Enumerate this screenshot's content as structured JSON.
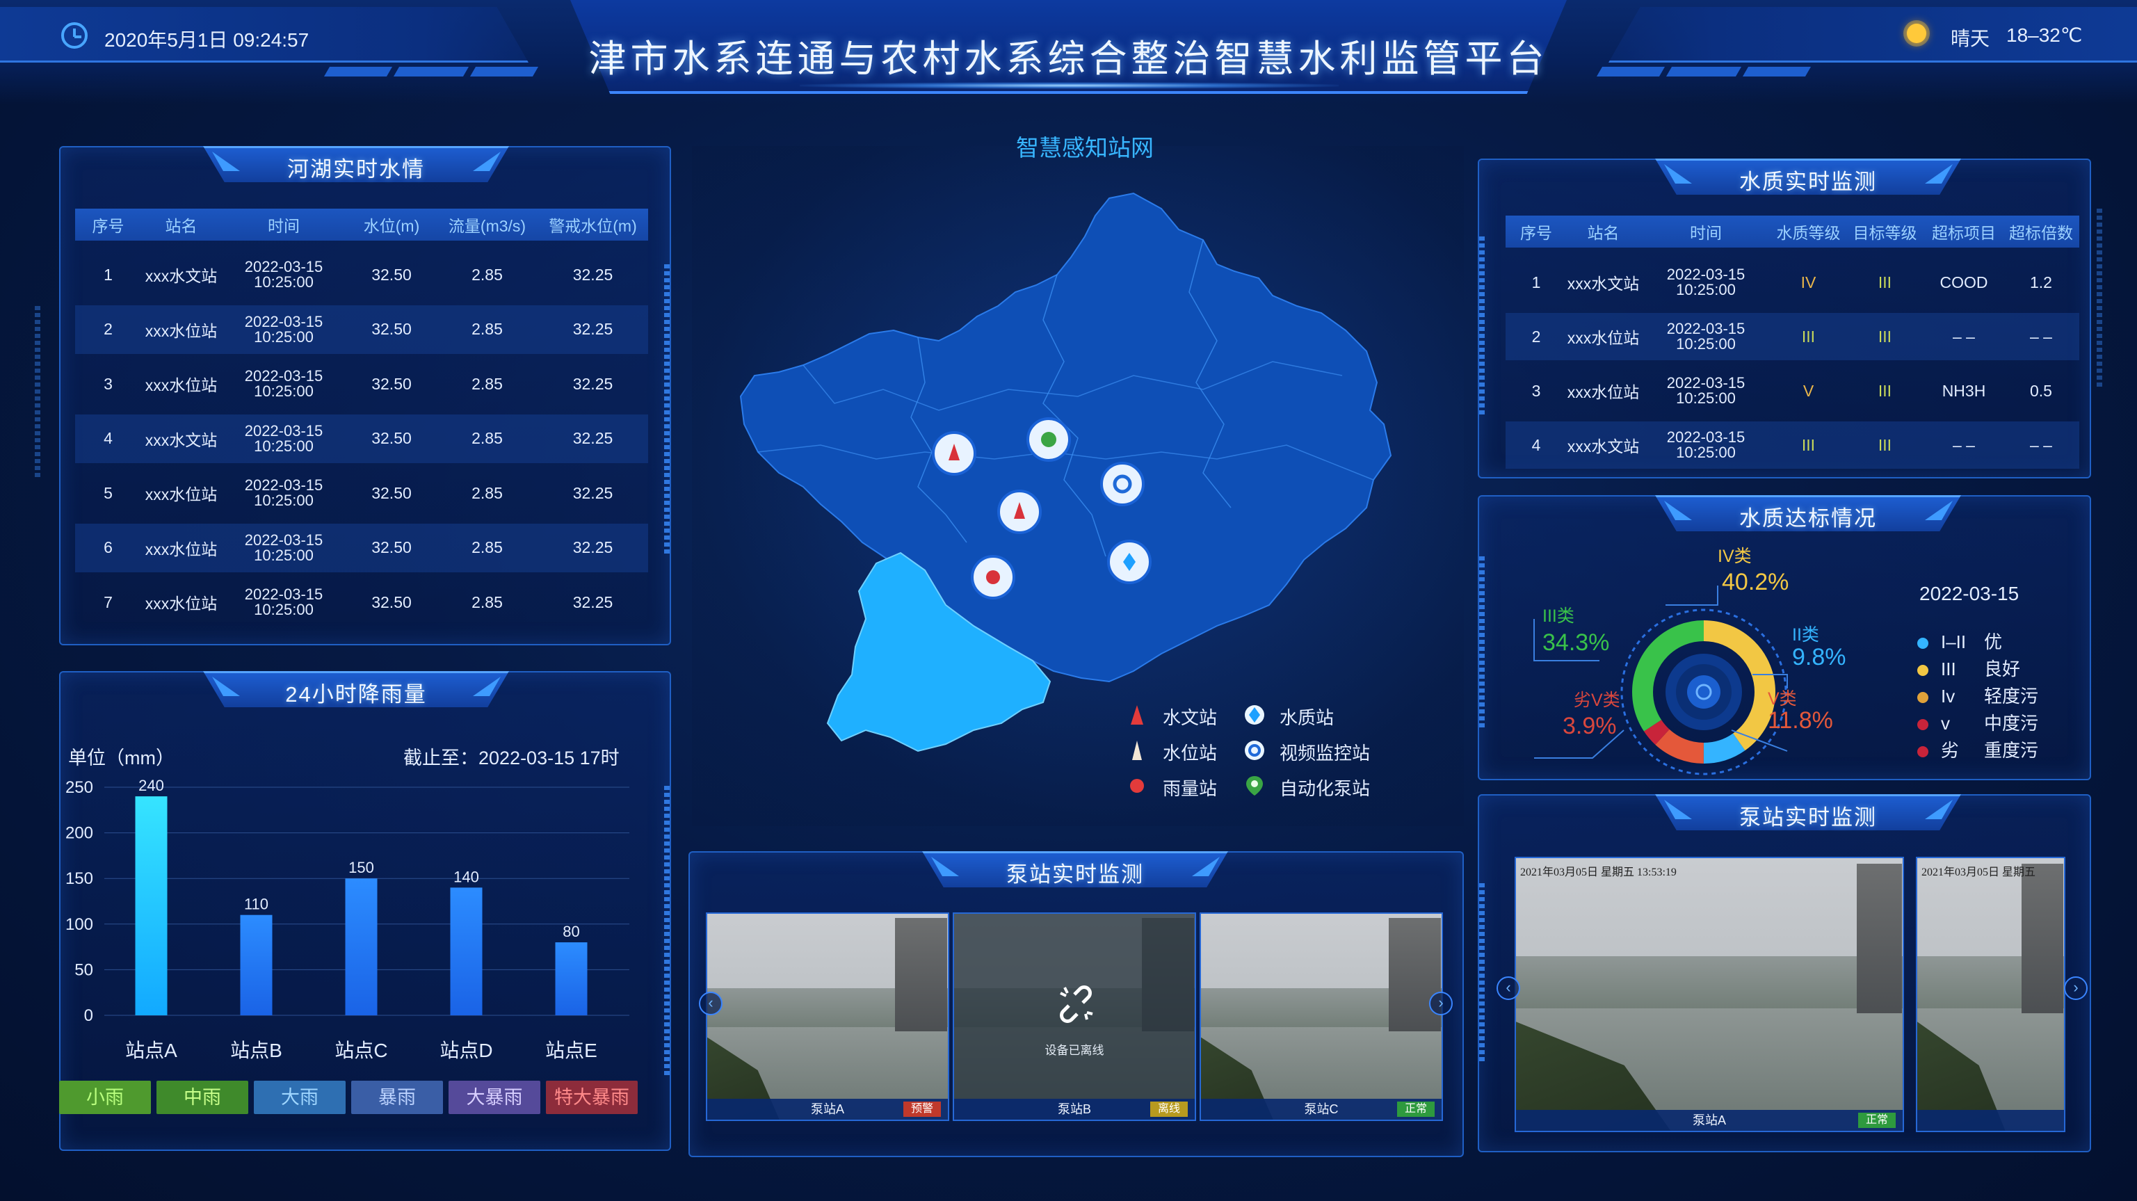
{
  "header": {
    "title": "津市水系连通与农村水系综合整治智慧水利监管平台",
    "datetime": "2020年5月1日  09:24:57",
    "weather": "晴天",
    "temperature": "18–32℃"
  },
  "river_panel": {
    "title": "河湖实时水情",
    "columns": [
      "序号",
      "站名",
      "时间",
      "水位(m)",
      "流量(m3/s)",
      "警戒水位(m)"
    ],
    "rows": [
      {
        "no": "1",
        "name": "xxx水文站",
        "date": "2022-03-15",
        "time": "10:25:00",
        "level": "32.50",
        "flow": "2.85",
        "warn": "32.25"
      },
      {
        "no": "2",
        "name": "xxx水位站",
        "date": "2022-03-15",
        "time": "10:25:00",
        "level": "32.50",
        "flow": "2.85",
        "warn": "32.25"
      },
      {
        "no": "3",
        "name": "xxx水位站",
        "date": "2022-03-15",
        "time": "10:25:00",
        "level": "32.50",
        "flow": "2.85",
        "warn": "32.25"
      },
      {
        "no": "4",
        "name": "xxx水文站",
        "date": "2022-03-15",
        "time": "10:25:00",
        "level": "32.50",
        "flow": "2.85",
        "warn": "32.25"
      },
      {
        "no": "5",
        "name": "xxx水位站",
        "date": "2022-03-15",
        "time": "10:25:00",
        "level": "32.50",
        "flow": "2.85",
        "warn": "32.25"
      },
      {
        "no": "6",
        "name": "xxx水位站",
        "date": "2022-03-15",
        "time": "10:25:00",
        "level": "32.50",
        "flow": "2.85",
        "warn": "32.25"
      },
      {
        "no": "7",
        "name": "xxx水位站",
        "date": "2022-03-15",
        "time": "10:25:00",
        "level": "32.50",
        "flow": "2.85",
        "warn": "32.25"
      }
    ]
  },
  "rain_panel": {
    "title": "24小时降雨量",
    "unit_label": "单位（mm）",
    "cutoff_label": "截止至：2022-03-15 17时",
    "legend": [
      {
        "label": "小雨",
        "bg": "#4f9a2e",
        "fg": "#b9ff7e"
      },
      {
        "label": "中雨",
        "bg": "#3f8a2b",
        "fg": "#c8ff8a"
      },
      {
        "label": "大雨",
        "bg": "#2e6fb2",
        "fg": "#9fd6ff"
      },
      {
        "label": "暴雨",
        "bg": "#3a5ea6",
        "fg": "#bcd3ff"
      },
      {
        "label": "大暴雨",
        "bg": "#554a9a",
        "fg": "#d8cfff"
      },
      {
        "label": "特大暴雨",
        "bg": "#8d2c3b",
        "fg": "#ff8a8a"
      }
    ]
  },
  "chart_data": {
    "type": "bar",
    "categories": [
      "站点A",
      "站点B",
      "站点C",
      "站点D",
      "站点E"
    ],
    "values": [
      240,
      110,
      150,
      140,
      80
    ],
    "ylim": [
      0,
      250
    ],
    "yticks": [
      0,
      50,
      100,
      150,
      200,
      250
    ],
    "ylabel": "单位（mm）",
    "xlabel": "",
    "grid": true
  },
  "map_panel": {
    "title": "智慧感知站网",
    "legend": [
      {
        "label": "水文站",
        "icon": "hydrology-station-icon"
      },
      {
        "label": "水位站",
        "icon": "water-level-station-icon"
      },
      {
        "label": "雨量站",
        "icon": "rain-station-icon"
      },
      {
        "label": "水质站",
        "icon": "water-quality-station-icon"
      },
      {
        "label": "视频监控站",
        "icon": "video-station-icon"
      },
      {
        "label": "自动化泵站",
        "icon": "pump-station-icon"
      }
    ]
  },
  "pump_center": {
    "title": "泵站实时监测",
    "offline_text": "设备已离线",
    "cams": [
      {
        "name": "泵站A",
        "status": "预警",
        "status_color": "#c0392b"
      },
      {
        "name": "泵站B",
        "status": "离线",
        "status_color": "#b79a1f"
      },
      {
        "name": "泵站C",
        "status": "正常",
        "status_color": "#2e9a3e"
      }
    ]
  },
  "quality_panel": {
    "title": "水质实时监测",
    "columns": [
      "序号",
      "站名",
      "时间",
      "水质等级",
      "目标等级",
      "超标项目",
      "超标倍数"
    ],
    "rows": [
      {
        "no": "1",
        "name": "xxx水文站",
        "date": "2022-03-15",
        "time": "10:25:00",
        "grade": "IV",
        "grade_color": "#e9b64a",
        "target": "III",
        "item": "COOD",
        "times": "1.2"
      },
      {
        "no": "2",
        "name": "xxx水位站",
        "date": "2022-03-15",
        "time": "10:25:00",
        "grade": "III",
        "grade_color": "#c8d95a",
        "target": "III",
        "item": "– –",
        "times": "– –"
      },
      {
        "no": "3",
        "name": "xxx水位站",
        "date": "2022-03-15",
        "time": "10:25:00",
        "grade": "V",
        "grade_color": "#e9b64a",
        "target": "III",
        "item": "NH3H",
        "times": "0.5"
      },
      {
        "no": "4",
        "name": "xxx水文站",
        "date": "2022-03-15",
        "time": "10:25:00",
        "grade": "III",
        "grade_color": "#c8d95a",
        "target": "III",
        "item": "– –",
        "times": "– –"
      }
    ]
  },
  "compliance_panel": {
    "title": "水质达标情况",
    "date": "2022-03-15",
    "segments": [
      {
        "label": "IV类",
        "value": "40.2%",
        "fraction": 0.402,
        "color": "#f2c744"
      },
      {
        "label": "II类",
        "value": "9.8%",
        "fraction": 0.098,
        "color": "#34b4ff"
      },
      {
        "label": "V类",
        "value": "11.8%",
        "fraction": 0.118,
        "color": "#e4583a"
      },
      {
        "label": "劣V类",
        "value": "3.9%",
        "fraction": 0.039,
        "color": "#c8243a"
      },
      {
        "label": "III类",
        "value": "34.3%",
        "fraction": 0.343,
        "color": "#39c24a"
      }
    ],
    "legend": [
      {
        "grade": "I–II",
        "desc": "优",
        "color": "#34b4ff"
      },
      {
        "grade": "III",
        "desc": "良好",
        "color": "#f2c744"
      },
      {
        "grade": "Iv",
        "desc": "轻度污",
        "color": "#e0a23a"
      },
      {
        "grade": "v",
        "desc": "中度污",
        "color": "#c8243a"
      },
      {
        "grade": "劣",
        "desc": "重度污",
        "color": "#c8243a"
      }
    ]
  },
  "pump_right": {
    "title": "泵站实时监测",
    "stamp": "2021年03月05日  星期五  13:53:19",
    "stamp_short": "2021年03月05日  星期五",
    "cam_name": "泵站A",
    "cam_status": "正常"
  }
}
